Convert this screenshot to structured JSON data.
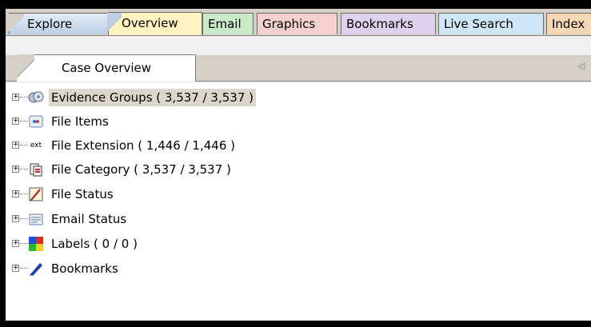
{
  "top_tabs": [
    {
      "label": "Explore"
    },
    {
      "label": "Overview"
    },
    {
      "label": "Email"
    },
    {
      "label": "Graphics"
    },
    {
      "label": "Bookmarks"
    },
    {
      "label": "Live Search"
    },
    {
      "label": "Index"
    }
  ],
  "sub_tabs": [
    {
      "label": "Case Overview"
    }
  ],
  "tree": {
    "items": [
      {
        "label": "Evidence Groups ( 3,537 / 3,537 )",
        "icon": "evidence-groups-icon"
      },
      {
        "label": "File Items",
        "icon": "file-items-icon"
      },
      {
        "label": "File Extension ( 1,446 / 1,446 )",
        "icon": "ext-icon",
        "icon_text": "ext"
      },
      {
        "label": "File Category ( 3,537 / 3,537 )",
        "icon": "file-category-icon"
      },
      {
        "label": "File Status",
        "icon": "file-status-icon"
      },
      {
        "label": "Email Status",
        "icon": "email-status-icon"
      },
      {
        "label": "Labels ( 0 / 0 )",
        "icon": "labels-icon"
      },
      {
        "label": "Bookmarks",
        "icon": "bookmarks-icon"
      }
    ],
    "expander_symbol": "+"
  },
  "colors": {
    "frame_bg": "#000000",
    "selected_bg": "#dcd6cc",
    "overview_tab": "#fff4c0",
    "email_tab": "#c9e9c9",
    "graphics_tab": "#f6cfcf",
    "bookmarks_tab": "#ddd1ee",
    "live_search_tab": "#cfe6f6",
    "index_tab": "#f8d8b4"
  }
}
